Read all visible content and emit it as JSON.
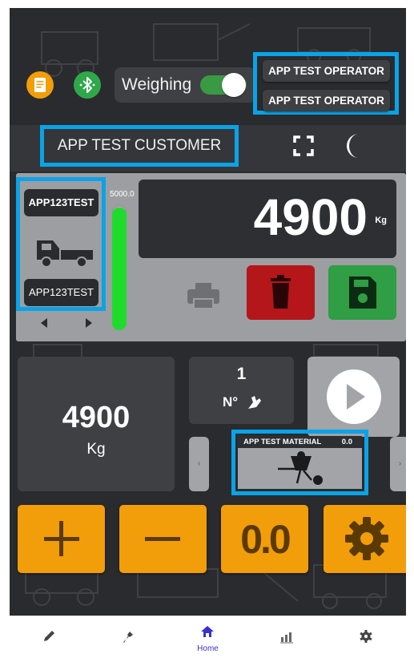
{
  "header": {
    "weighing_label": "Weighing",
    "weighing_enabled": true,
    "operators": [
      "APP TEST OPERATOR",
      "APP TEST OPERATOR"
    ]
  },
  "customer": {
    "name": "APP TEST CUSTOMER"
  },
  "vehicle": {
    "plate_top": "APP123TEST",
    "plate_bottom": "APP123TEST"
  },
  "gauge": {
    "max_label": "5000.0",
    "fill_fraction": 0.98
  },
  "display": {
    "weight": "4900",
    "unit": "Kg"
  },
  "summary": {
    "total_weight": "4900",
    "total_unit": "Kg",
    "count": "1",
    "count_label": "N°"
  },
  "material": {
    "name": "APP TEST MATERIAL",
    "quantity": "0.0"
  },
  "controls": {
    "zero_label": "0.0"
  },
  "nav": {
    "home_label": "Home"
  },
  "colors": {
    "accent_blue": "#0aa3e8",
    "orange": "#f29d0a",
    "green": "#3a9a43",
    "red": "#b5161a",
    "nav_active": "#3a2fd0"
  },
  "icons": [
    "receipt-icon",
    "bluetooth-icon",
    "fullscreen-icon",
    "moon-icon",
    "truck-icon",
    "printer-icon",
    "trash-icon",
    "save-icon",
    "play-icon",
    "hand-icon",
    "wheelbarrow-icon",
    "plus-icon",
    "minus-icon",
    "gear-icon",
    "pencil-icon",
    "tool-icon",
    "home-icon",
    "chart-icon",
    "settings-icon"
  ]
}
